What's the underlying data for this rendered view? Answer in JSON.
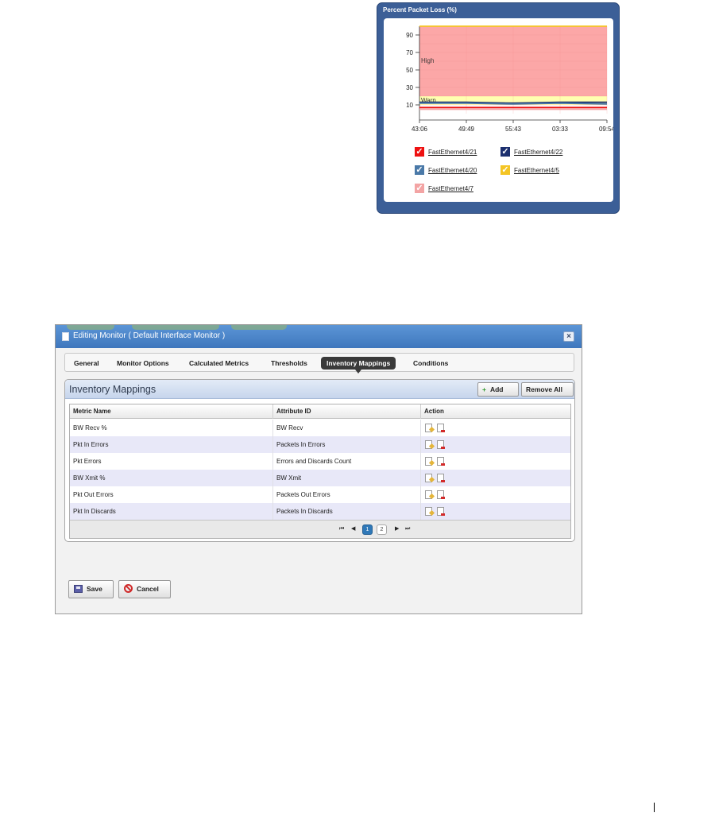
{
  "chart": {
    "title": "Percent Packet Loss (%)",
    "legend": [
      {
        "label": "FastEthernet4/21",
        "color": "#ee1111"
      },
      {
        "label": "FastEthernet4/22",
        "color": "#1c2f6e"
      },
      {
        "label": "FastEthernet4/20",
        "color": "#4a79a8"
      },
      {
        "label": "FastEthernet4/5",
        "color": "#f4c524"
      },
      {
        "label": "FastEthernet4/7",
        "color": "#f3a4a4"
      }
    ]
  },
  "chart_data": {
    "type": "line",
    "title": "Percent Packet Loss (%)",
    "xlabel": "",
    "ylabel": "",
    "x_ticks": [
      "43:06",
      "49:49",
      "55:43",
      "03:33",
      "09:54"
    ],
    "y_ticks": [
      10,
      30,
      50,
      70,
      90
    ],
    "ylim": [
      0,
      100
    ],
    "grid": true,
    "threshold_bands": [
      {
        "label": "High",
        "from": 20,
        "to": 100,
        "color": "#fca7a7"
      },
      {
        "label": "Warn",
        "from": 10,
        "to": 20,
        "color": "#ffffb0"
      }
    ],
    "series": [
      {
        "name": "FastEthernet4/21",
        "color": "#ee1111",
        "values": [
          7,
          7,
          7,
          7,
          7
        ]
      },
      {
        "name": "FastEthernet4/22",
        "color": "#1c2f6e",
        "values": [
          13,
          13,
          12,
          13,
          13
        ]
      },
      {
        "name": "FastEthernet4/20",
        "color": "#4a79a8",
        "values": [
          12,
          12,
          11,
          12,
          11
        ]
      },
      {
        "name": "FastEthernet4/5",
        "color": "#f4c524",
        "values": [
          100,
          100,
          100,
          100,
          100
        ]
      },
      {
        "name": "FastEthernet4/7",
        "color": "#f3a4a4",
        "values": [
          5,
          5,
          5,
          5,
          5
        ]
      }
    ]
  },
  "dialog": {
    "title": "Editing Monitor ( Default Interface Monitor )",
    "close_label": "×",
    "tabs": [
      {
        "label": "General",
        "active": false
      },
      {
        "label": "Monitor Options",
        "active": false
      },
      {
        "label": "Calculated Metrics",
        "active": false
      },
      {
        "label": "Thresholds",
        "active": false
      },
      {
        "label": "Inventory Mappings",
        "active": true
      },
      {
        "label": "Conditions",
        "active": false
      }
    ],
    "panel": {
      "title": "Inventory Mappings",
      "add_label": "Add",
      "remove_all_label": "Remove All",
      "columns": [
        "Metric Name",
        "Attribute ID",
        "Action"
      ],
      "rows": [
        {
          "metric": "BW Recv %",
          "attribute": "BW Recv"
        },
        {
          "metric": "Pkt In Errors",
          "attribute": "Packets In Errors"
        },
        {
          "metric": "Pkt Errors",
          "attribute": "Errors and Discards Count"
        },
        {
          "metric": "BW Xmit %",
          "attribute": "BW Xmit"
        },
        {
          "metric": "Pkt Out Errors",
          "attribute": "Packets Out Errors"
        },
        {
          "metric": "Pkt In Discards",
          "attribute": "Packets In Discards"
        }
      ],
      "pager": {
        "first": "⏮",
        "prev": "◀",
        "next": "▶",
        "last": "⏭",
        "current_page": "1",
        "other_page": "2"
      }
    },
    "save_label": "Save",
    "cancel_label": "Cancel"
  }
}
